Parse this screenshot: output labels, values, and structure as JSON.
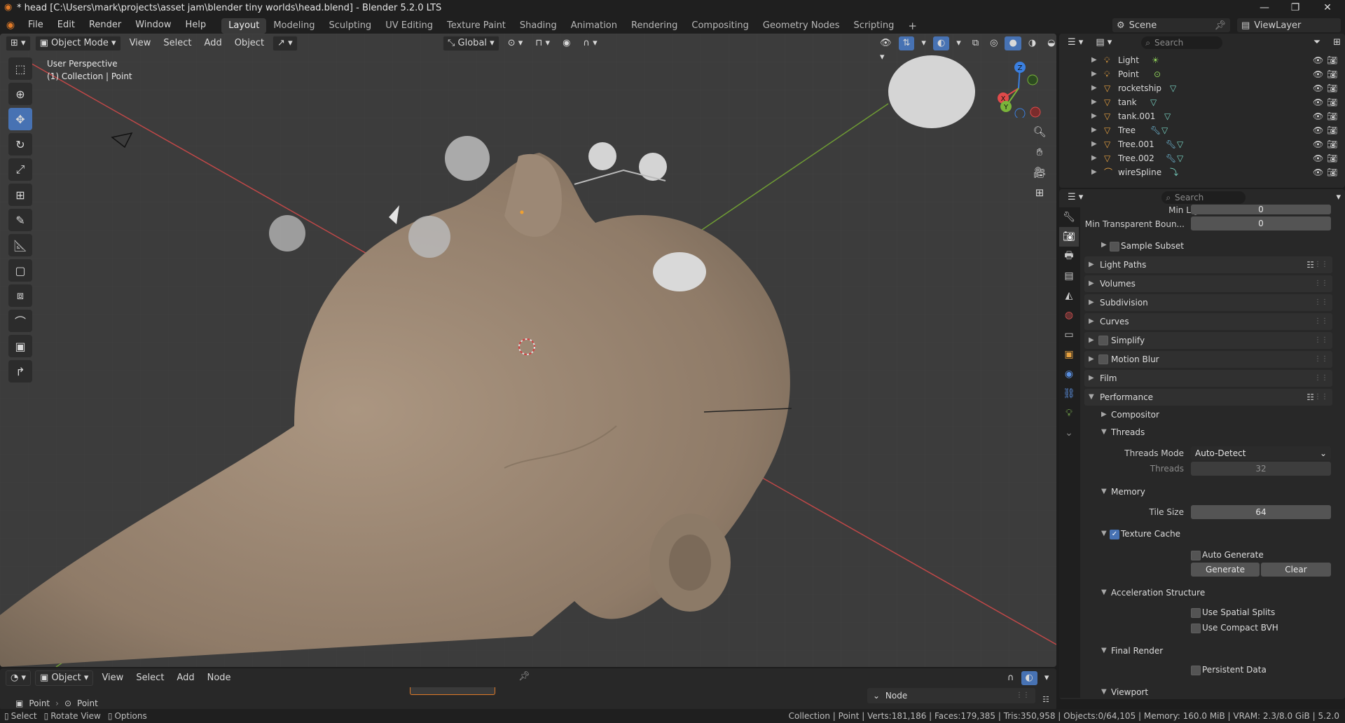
{
  "window": {
    "title": "* head [C:\\Users\\mark\\projects\\asset jam\\blender tiny worlds\\head.blend] - Blender 5.2.0 LTS"
  },
  "menu": [
    "File",
    "Edit",
    "Render",
    "Window",
    "Help"
  ],
  "workspaces": [
    "Layout",
    "Modeling",
    "Sculpting",
    "UV Editing",
    "Texture Paint",
    "Shading",
    "Animation",
    "Rendering",
    "Compositing",
    "Geometry Nodes",
    "Scripting"
  ],
  "active_workspace": "Layout",
  "scene": {
    "scene_name": "Scene",
    "view_layer": "ViewLayer"
  },
  "viewport": {
    "mode": "Object Mode",
    "menus": [
      "View",
      "Select",
      "Add",
      "Object"
    ],
    "transform_orientation": "Global",
    "overlay_title": "User Perspective",
    "overlay_subtitle": "(1) Collection | Point",
    "gizmo_axes": {
      "x": "X",
      "y": "Y",
      "z": "Z"
    }
  },
  "outliner": {
    "search_placeholder": "Search",
    "items": [
      {
        "name": "Light",
        "icon": "light-icon"
      },
      {
        "name": "Point",
        "icon": "light-icon"
      },
      {
        "name": "rocketship",
        "icon": "mesh-icon"
      },
      {
        "name": "tank",
        "icon": "mesh-icon"
      },
      {
        "name": "tank.001",
        "icon": "mesh-icon"
      },
      {
        "name": "Tree",
        "icon": "mesh-icon"
      },
      {
        "name": "Tree.001",
        "icon": "mesh-icon"
      },
      {
        "name": "Tree.002",
        "icon": "mesh-icon"
      },
      {
        "name": "wireSpline",
        "icon": "curve-icon"
      }
    ]
  },
  "properties": {
    "search_placeholder": "Search",
    "min_light_bounces_label": "Min Light Bounces",
    "min_light_bounces_value": "0",
    "min_transparent_label": "Min Transparent Boun...",
    "min_transparent_value": "0",
    "sample_subset": "Sample Subset",
    "panels": [
      "Light Paths",
      "Volumes",
      "Subdivision",
      "Curves",
      "Simplify",
      "Motion Blur",
      "Film",
      "Performance"
    ],
    "compositor": "Compositor",
    "threads": "Threads",
    "threads_mode_label": "Threads Mode",
    "threads_mode_value": "Auto-Detect",
    "threads_label": "Threads",
    "threads_value": "32",
    "memory": "Memory",
    "tile_size_label": "Tile Size",
    "tile_size_value": "64",
    "texture_cache": "Texture Cache",
    "auto_generate": "Auto Generate",
    "generate": "Generate",
    "clear": "Clear",
    "accel": "Acceleration Structure",
    "spatial_splits": "Use Spatial Splits",
    "compact_bvh": "Use Compact BVH",
    "final_render": "Final Render",
    "persistent_data": "Persistent Data",
    "viewport_section": "Viewport"
  },
  "node_editor": {
    "mode": "Object",
    "menus": [
      "View",
      "Select",
      "Add",
      "Node"
    ],
    "breadcrumb_1": "Point",
    "breadcrumb_2": "Point",
    "sidebar_tab": "Node"
  },
  "status": {
    "select": "Select",
    "rotate": "Rotate View",
    "options": "Options",
    "stats": "Collection | Point | Verts:181,186 | Faces:179,385 | Tris:350,958 | Objects:0/64,105 | Memory: 160.0 MiB | VRAM: 2.3/8.0 GiB | 5.2.0"
  },
  "colors": {
    "accent": "#4772b3",
    "x_axis": "#e04a4a",
    "y_axis": "#7ab43a",
    "z_axis": "#3a7fe0",
    "skin": "#a08c78"
  }
}
